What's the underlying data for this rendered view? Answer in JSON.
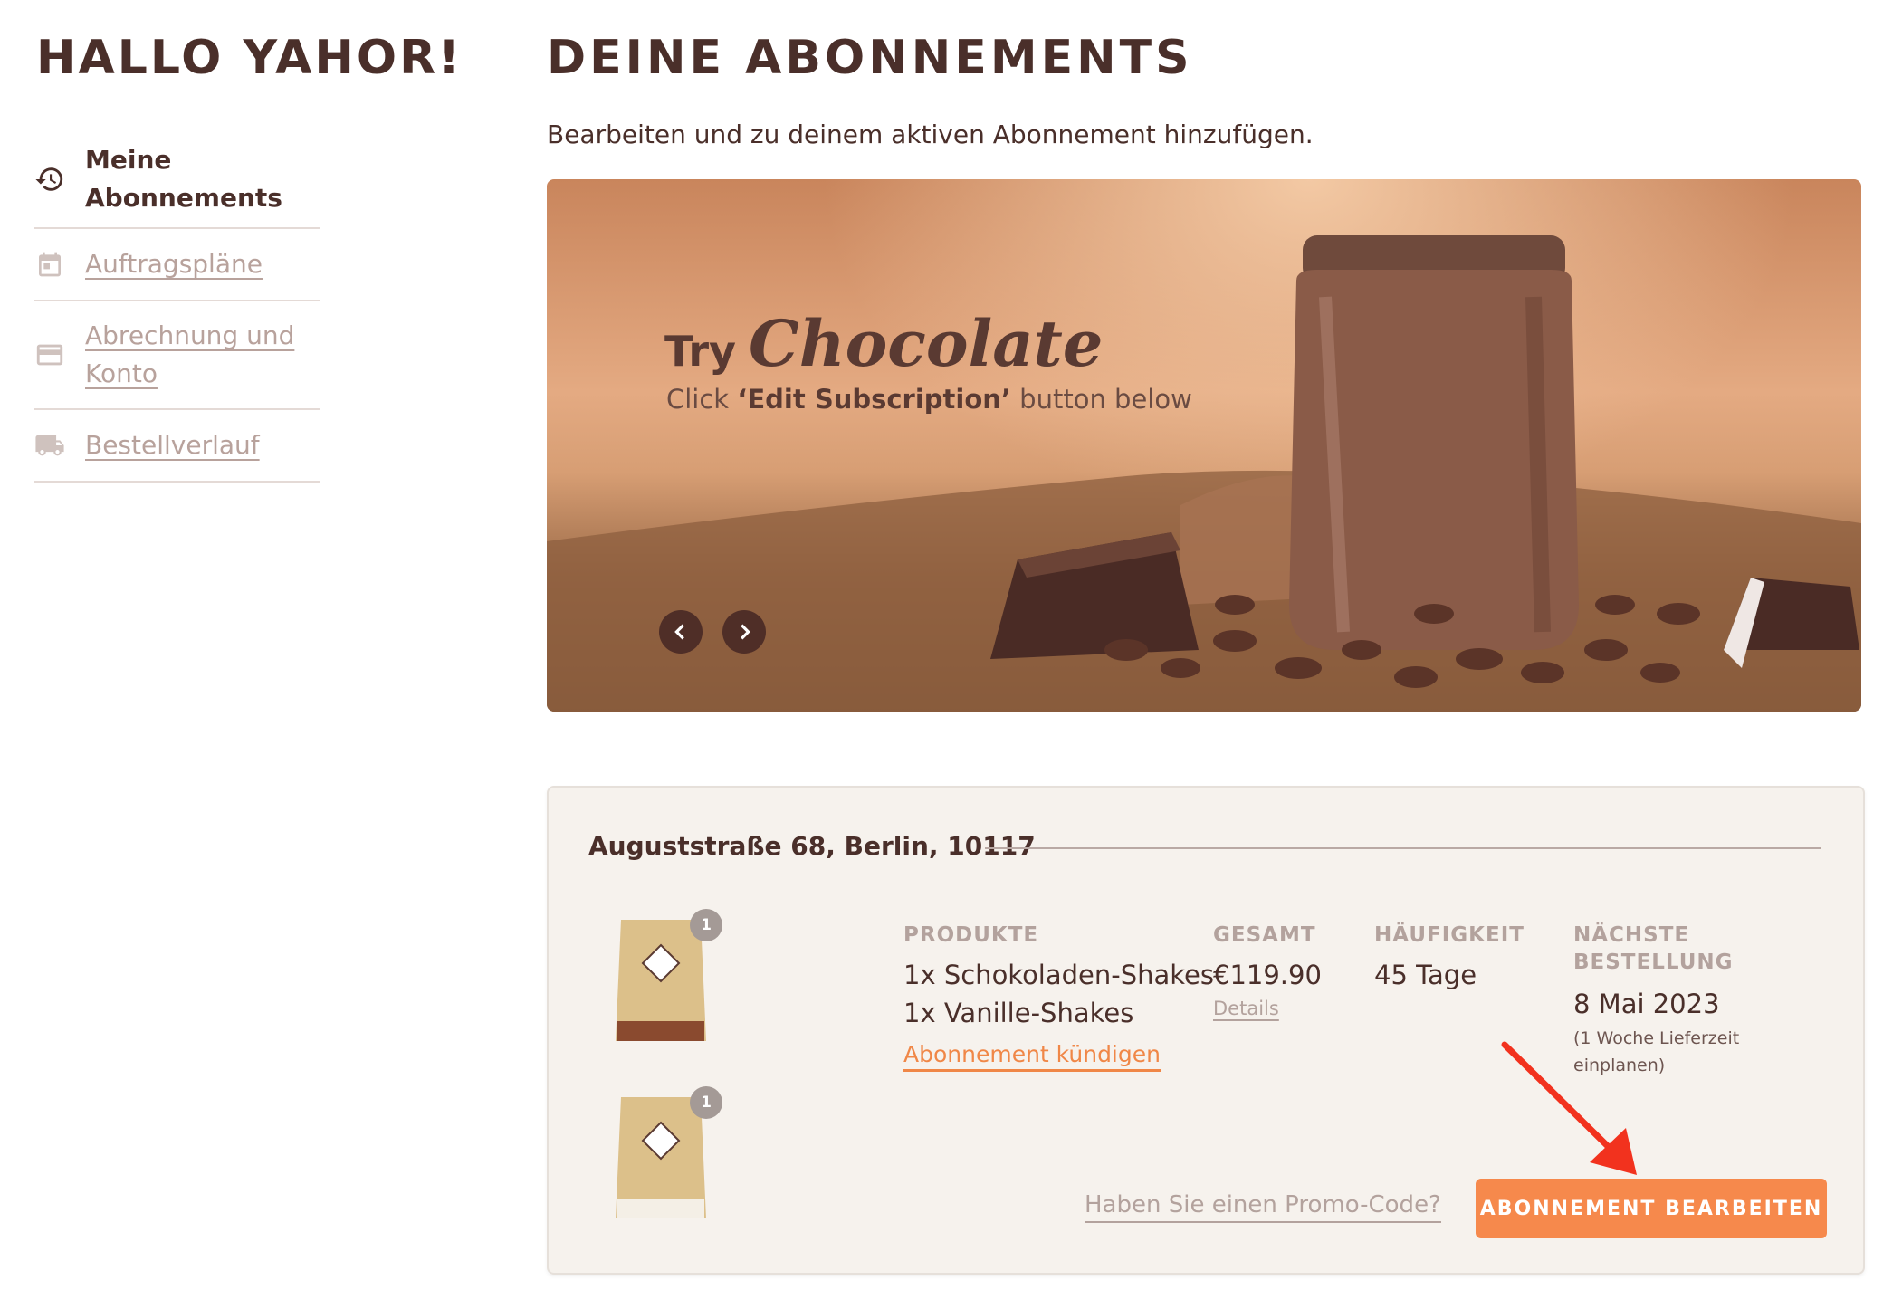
{
  "sidebar": {
    "greeting": "HALLO YAHOR!",
    "items": [
      {
        "label": "Meine Abonnements",
        "icon": "history-icon",
        "active": true
      },
      {
        "label": "Auftragspläne",
        "icon": "calendar-icon",
        "active": false
      },
      {
        "label": "Abrechnung und Konto",
        "icon": "credit-card-icon",
        "active": false
      },
      {
        "label": "Bestellverlauf",
        "icon": "truck-icon",
        "active": false
      }
    ]
  },
  "main": {
    "title": "DEINE ABONNEMENTS",
    "subtitle": "Bearbeiten und zu deinem aktiven Abonnement hinzufügen."
  },
  "banner": {
    "try": "Try",
    "product": "Chocolate",
    "cta_prefix": "Click",
    "cta_bold": "‘Edit Subscription’",
    "cta_suffix": "button below"
  },
  "subscription": {
    "address": "Auguststraße 68, Berlin, 10117",
    "products_header": "PRODUKTE",
    "products": [
      "1x Schokoladen-Shakes",
      "1x Vanille-Shakes"
    ],
    "product_badges": [
      "1",
      "1"
    ],
    "cancel_label": "Abonnement kündigen",
    "total_header": "GESAMT",
    "total": "€119.90",
    "details_label": "Details",
    "frequency_header": "HÄUFIGKEIT",
    "frequency": "45 Tage",
    "next_header_line1": "NÄCHSTE",
    "next_header_line2": "BESTELLUNG",
    "next_date": "8 Mai 2023",
    "next_note_line1": "(1 Woche Lieferzeit",
    "next_note_line2": "einplanen)",
    "promo_label": "Haben Sie einen Promo-Code?",
    "edit_label": "ABONNEMENT BEARBEITEN"
  },
  "colors": {
    "brand_brown": "#4a2f2a",
    "accent_orange": "#f6894c",
    "muted": "#b3a29d",
    "annotation_red": "#f2321e"
  }
}
